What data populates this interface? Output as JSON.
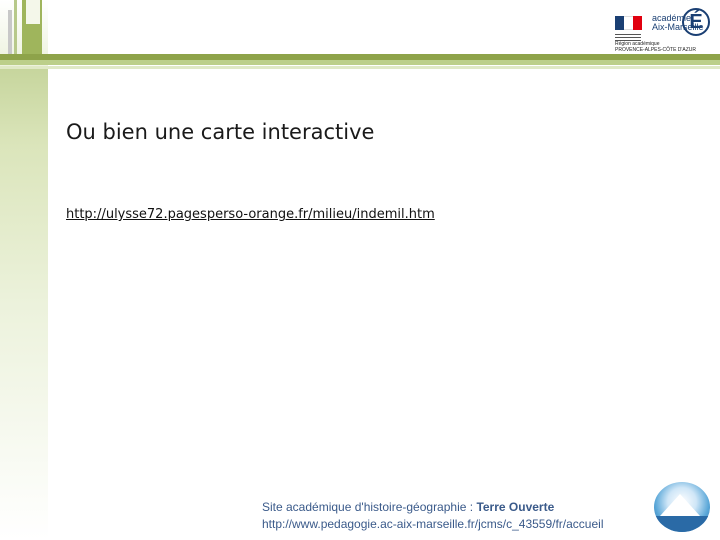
{
  "logo": {
    "academie_line1": "académie",
    "academie_line2": "Aix-Marseille",
    "letter": "É",
    "region_line1": "Région académique",
    "region_line2": "PROVENCE-ALPES-CÔTE D'AZUR",
    "colors": {
      "blue": "#1a3f73",
      "red": "#e1000f",
      "white": "#ffffff"
    }
  },
  "slide": {
    "title": "Ou bien une carte interactive",
    "link": "http://ulysse72.pagesperso-orange.fr/milieu/indemil.htm"
  },
  "footer": {
    "line1_prefix": "Site académique d'histoire-géographie : ",
    "line1_bold": "Terre Ouverte",
    "line2": "http://www.pedagogie.ac-aix-marseille.fr/jcms/c_43559/fr/accueil"
  },
  "theme": {
    "accent": "#9fb55c",
    "accent_dark": "#8ea34a",
    "footer_text": "#3a5a8a"
  }
}
